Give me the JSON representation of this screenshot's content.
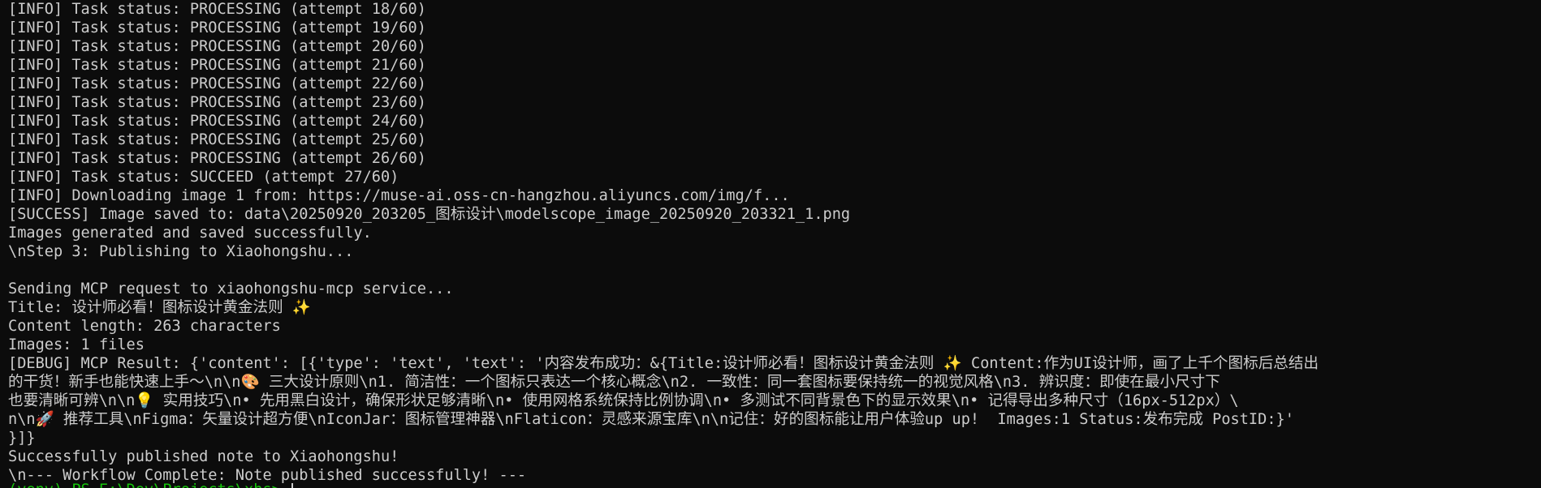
{
  "terminal": {
    "lines": [
      "[INFO] Task status: PROCESSING (attempt 18/60)",
      "[INFO] Task status: PROCESSING (attempt 19/60)",
      "[INFO] Task status: PROCESSING (attempt 20/60)",
      "[INFO] Task status: PROCESSING (attempt 21/60)",
      "[INFO] Task status: PROCESSING (attempt 22/60)",
      "[INFO] Task status: PROCESSING (attempt 23/60)",
      "[INFO] Task status: PROCESSING (attempt 24/60)",
      "[INFO] Task status: PROCESSING (attempt 25/60)",
      "[INFO] Task status: PROCESSING (attempt 26/60)",
      "[INFO] Task status: SUCCEED (attempt 27/60)",
      "[INFO] Downloading image 1 from: https://muse-ai.oss-cn-hangzhou.aliyuncs.com/img/f...",
      "[SUCCESS] Image saved to: data\\20250920_203205_图标设计\\modelscope_image_20250920_203321_1.png",
      "Images generated and saved successfully.",
      "\\nStep 3: Publishing to Xiaohongshu...",
      "",
      "Sending MCP request to xiaohongshu-mcp service...",
      "Title: 设计师必看！图标设计黄金法则 ✨",
      "Content length: 263 characters",
      "Images: 1 files",
      "[DEBUG] MCP Result: {'content': [{'type': 'text', 'text': '内容发布成功：&{Title:设计师必看！图标设计黄金法则 ✨ Content:作为UI设计师，画了上千个图标后总结出",
      "的干货！新手也能快速上手～\\n\\n🎨 三大设计原则\\n1. 简洁性：一个图标只表达一个核心概念\\n2. 一致性：同一套图标要保持统一的视觉风格\\n3. 辨识度：即使在最小尺寸下",
      "也要清晰可辨\\n\\n💡 实用技巧\\n• 先用黑白设计，确保形状足够清晰\\n• 使用网格系统保持比例协调\\n• 多测试不同背景色下的显示效果\\n• 记得导出多种尺寸（16px-512px）\\",
      "n\\n🚀 推荐工具\\nFigma：矢量设计超方便\\nIconJar：图标管理神器\\nFlaticon：灵感来源宝库\\n\\n记住：好的图标能让用户体验up up!  Images:1 Status:发布完成 PostID:}'",
      "}]}",
      "Successfully published note to Xiaohongshu!",
      "\\n--- Workflow Complete: Note published successfully! ---"
    ],
    "prompt_fragment": "(venv) PS E:\\Dev\\Projects\\xhs> "
  }
}
